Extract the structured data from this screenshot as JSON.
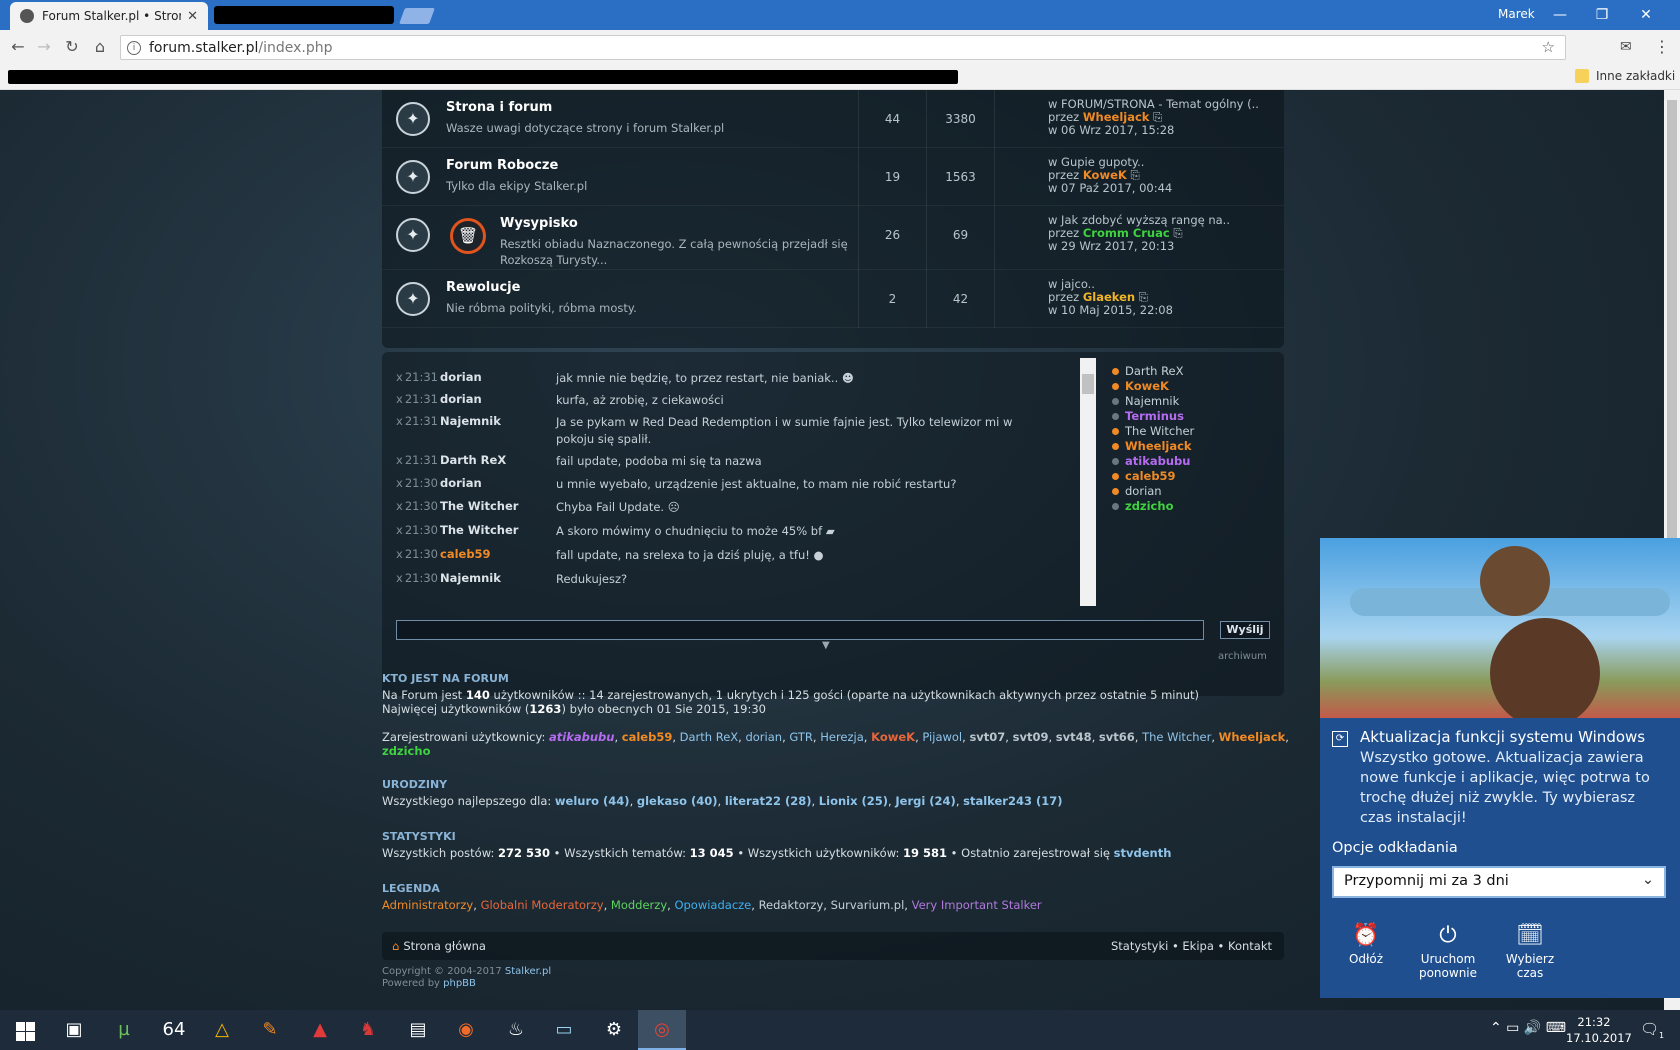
{
  "browser": {
    "tab_title": "Forum Stalker.pl • Strona",
    "user": "Marek",
    "url_host": "forum.stalker.pl",
    "url_path": "/index.php",
    "bookmarks_other": "Inne zakładki"
  },
  "forums": [
    {
      "name": "Strona i forum",
      "desc": "Wasze uwagi dotyczące strony i forum Stalker.pl",
      "topics": "44",
      "posts": "3380",
      "last_in": "w FORUM/STRONA - Temat ogólny (..",
      "last_by_prefix": "przez",
      "last_by": "Wheeljack",
      "last_date": "w 06 Wrz 2017, 15:28"
    },
    {
      "name": "Forum Robocze",
      "desc": "Tylko dla ekipy Stalker.pl",
      "topics": "19",
      "posts": "1563",
      "last_in": "w Gupie gupoty..",
      "last_by_prefix": "przez",
      "last_by": "KoweK",
      "last_date": "w 07 Paź 2017, 00:44"
    },
    {
      "name": "Wysypisko",
      "desc": "Resztki obiadu Naznaczonego. Z całą pewnością przejadł się Rozkoszą Turysty...",
      "topics": "26",
      "posts": "69",
      "last_in": "w Jak zdobyć wyższą rangę na..",
      "last_by_prefix": "przez",
      "last_by": "Cromm Cruac",
      "last_date": "w 29 Wrz 2017, 20:13"
    },
    {
      "name": "Rewolucje",
      "desc": "Nie róbma polityki, róbma mosty.",
      "topics": "2",
      "posts": "42",
      "last_in": "w jajco..",
      "last_by_prefix": "przez",
      "last_by": "Glaeken",
      "last_date": "w 10 Maj 2015, 22:08"
    }
  ],
  "shoutbox": {
    "messages": [
      {
        "del": "x",
        "time": "21:31",
        "user": "dorian",
        "text": "jak mnie nie będzię, to przez restart, nie baniak.."
      },
      {
        "del": "x",
        "time": "21:31",
        "user": "dorian",
        "text": "kurfa, aż zrobię, z ciekawości"
      },
      {
        "del": "x",
        "time": "21:31",
        "user": "Najemnik",
        "text": "Ja se pykam w Red Dead Redemption i w sumie fajnie jest. Tylko telewizor mi w pokoju się spalił."
      },
      {
        "del": "x",
        "time": "21:31",
        "user": "Darth ReX",
        "text": "fail update, podoba mi się ta nazwa"
      },
      {
        "del": "x",
        "time": "21:30",
        "user": "dorian",
        "text": "u mnie wyebało, urządzenie jest aktualne, to mam nie robić restartu?"
      },
      {
        "del": "x",
        "time": "21:30",
        "user": "The Witcher",
        "text": "Chyba Fail Update."
      },
      {
        "del": "x",
        "time": "21:30",
        "user": "The Witcher",
        "text": "A skoro mówimy o chudnięciu to może 45% bf"
      },
      {
        "del": "x",
        "time": "21:30",
        "user": "caleb59",
        "text": "fall update, na srelexa to ja dziś pluję, a tfu!"
      },
      {
        "del": "x",
        "time": "21:30",
        "user": "Najemnik",
        "text": "Redukujesz?"
      }
    ],
    "online": [
      "Darth ReX",
      "KoweK",
      "Najemnik",
      "Terminus",
      "The Witcher",
      "Wheeljack",
      "atikabubu",
      "caleb59",
      "dorian",
      "zdzicho"
    ],
    "send_label": "Wyślij",
    "archive_label": "archiwum"
  },
  "who": {
    "heading": "KTO JEST NA FORUM",
    "line1_a": "Na Forum jest ",
    "line1_count": "140",
    "line1_b": " użytkowników :: 14 zarejestrowanych, 1 ukrytych i 125 gości (oparte na użytkownikach aktywnych przez ostatnie 5 minut)",
    "line2_a": "Najwięcej użytkowników (",
    "line2_count": "1263",
    "line2_b": ") było obecnych 01 Sie 2015, 19:30",
    "reg_label": "Zarejestrowani użytkownicy: ",
    "reg_users": [
      "atikabubu",
      "caleb59",
      "Darth ReX",
      "dorian",
      "GTR",
      "Herezja",
      "KoweK",
      "Pijawol",
      "svt07",
      "svt09",
      "svt48",
      "svt66",
      "The Witcher",
      "Wheeljack",
      "zdzicho"
    ]
  },
  "birthdays": {
    "heading": "URODZINY",
    "label": "Wszystkiego najlepszego dla: ",
    "users": [
      "weluro (44)",
      "glekaso (40)",
      "literat22 (28)",
      "Lionix (25)",
      "Jergi (24)",
      "stalker243 (17)"
    ]
  },
  "stats": {
    "heading": "STATYSTYKI",
    "posts_label": "Wszystkich postów: ",
    "posts": "272 530",
    "topics_label": "Wszystkich tematów: ",
    "topics": "13 045",
    "users_label": "Wszystkich użytkowników: ",
    "users": "19 581",
    "newest_label": "Ostatnio zarejestrował się ",
    "newest": "stvdenth"
  },
  "legend": {
    "heading": "LEGENDA",
    "items": [
      "Administratorzy",
      "Globalni Moderatorzy",
      "Modderzy",
      "Opowiadacze",
      "Redaktorzy",
      "Survarium.pl",
      "Very Important Stalker"
    ]
  },
  "footer": {
    "home": "Strona główna",
    "links": "Statystyki • Ekipa • Kontakt",
    "copyright_a": "Copyright © 2004-2017 ",
    "copyright_link": "Stalker.pl",
    "powered_a": "Powered by ",
    "powered_link": "phpBB"
  },
  "toast": {
    "title": "Aktualizacja funkcji systemu Windows",
    "body": "Wszystko gotowe. Aktualizacja zawiera nowe funkcje i aplikacje, więc potrwa to trochę dłużej niż zwykle. Ty wybierasz czas instalacji!",
    "options_label": "Opcje odkładania",
    "selected": "Przypomnij mi za 3 dni",
    "actions": [
      "Odłóż",
      "Uruchom ponownie",
      "Wybierz czas"
    ]
  },
  "taskbar": {
    "time": "21:32",
    "date": "17.10.2017",
    "notif_count": "1"
  }
}
